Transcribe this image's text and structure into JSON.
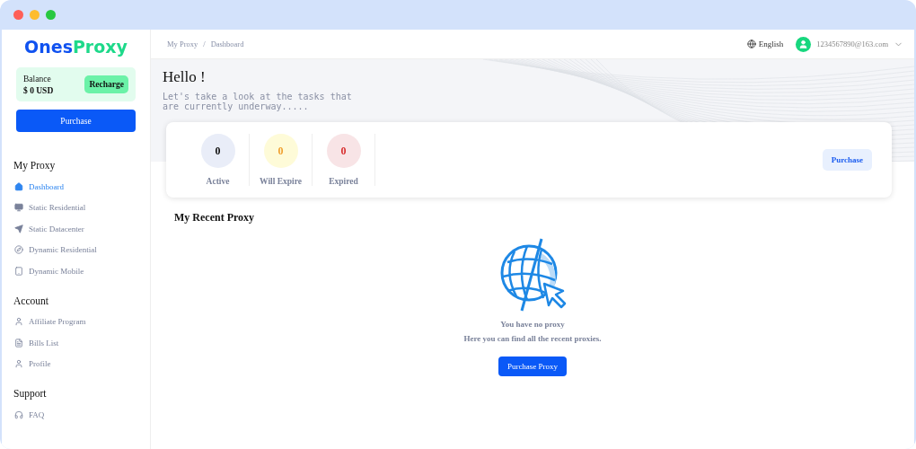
{
  "logo": {
    "first": "Ones",
    "second": "Proxy"
  },
  "balance": {
    "label": "Balance",
    "amount": "$ 0 USD",
    "button": "Recharge"
  },
  "purchase_button": "Purchase",
  "sidebar": [
    {
      "heading": "My Proxy",
      "items": [
        {
          "label": "Dashboard",
          "selected": true
        },
        {
          "label": "Static Residential",
          "selected": false
        },
        {
          "label": "Static Datacenter",
          "selected": false
        },
        {
          "label": "Dynamic Residential",
          "selected": false
        },
        {
          "label": "Dynamic Mobile",
          "selected": false
        }
      ]
    },
    {
      "heading": "Account",
      "items": [
        {
          "label": "Affiliate Program",
          "selected": false
        },
        {
          "label": "Bills List",
          "selected": false
        },
        {
          "label": "Profile",
          "selected": false
        }
      ]
    },
    {
      "heading": "Support",
      "items": [
        {
          "label": "FAQ",
          "selected": false
        }
      ]
    }
  ],
  "breadcrumb": [
    "My Proxy",
    "Dashboard"
  ],
  "breadcrumb_separator": "/",
  "language": "English",
  "user_email": "1234567890@163.com",
  "hero": {
    "title": "Hello !",
    "subtitle": "Let's take a look at the tasks that\nare currently underway....."
  },
  "stats": [
    {
      "value": "0",
      "label": "Active",
      "color": "#111111"
    },
    {
      "value": "0",
      "label": "Will Expire",
      "color": "#f0a030"
    },
    {
      "value": "0",
      "label": "Expired",
      "color": "#d83030"
    }
  ],
  "stats_button": "Purchase",
  "recent": {
    "title": "My Recent Proxy",
    "empty_title": "You have no proxy",
    "empty_text": "Here you can find all the recent proxies.",
    "button": "Purchase Proxy"
  }
}
